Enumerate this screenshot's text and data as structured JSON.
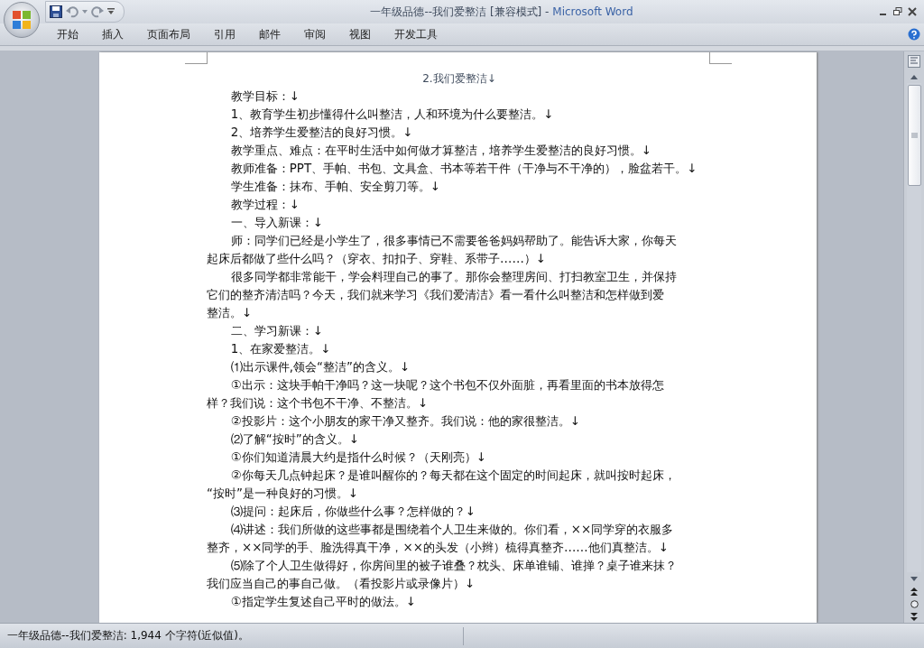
{
  "window": {
    "title": "一年级品德--我们爱整洁 [兼容模式]",
    "separator": "-",
    "app": "Microsoft Word"
  },
  "tabs": [
    {
      "label": "开始"
    },
    {
      "label": "插入"
    },
    {
      "label": "页面布局"
    },
    {
      "label": "引用"
    },
    {
      "label": "邮件"
    },
    {
      "label": "审阅"
    },
    {
      "label": "视图"
    },
    {
      "label": "开发工具"
    }
  ],
  "document": {
    "paragraphs": [
      {
        "kind": "title",
        "lines": [
          "2.我们爱整洁↓"
        ]
      },
      {
        "kind": "body",
        "lines": [
          "教学目标：↓"
        ]
      },
      {
        "kind": "body",
        "lines": [
          "1、教育学生初步懂得什么叫整洁，人和环境为什么要整洁。↓"
        ]
      },
      {
        "kind": "body",
        "lines": [
          "2、培养学生爱整洁的良好习惯。↓"
        ]
      },
      {
        "kind": "body",
        "lines": [
          "教学重点、难点：在平时生活中如何做才算整洁，培养学生爱整洁的良好习惯。↓"
        ]
      },
      {
        "kind": "body",
        "lines": [
          "教师准备：PPT、手帕、书包、文具盒、书本等若干件（干净与不干净的），脸盆若干。↓"
        ]
      },
      {
        "kind": "body",
        "lines": [
          "学生准备：抹布、手帕、安全剪刀等。↓"
        ]
      },
      {
        "kind": "body",
        "lines": [
          "教学过程：↓"
        ]
      },
      {
        "kind": "body",
        "lines": [
          "一、导入新课：↓"
        ]
      },
      {
        "kind": "body",
        "lines": [
          "师：同学们已经是小学生了，很多事情已不需要爸爸妈妈帮助了。能告诉大家，你每天",
          "起床后都做了些什么吗？（穿衣、扣扣子、穿鞋、系带子……）↓"
        ]
      },
      {
        "kind": "body",
        "lines": [
          "很多同学都非常能干，学会料理自己的事了。那你会整理房间、打扫教室卫生，并保持",
          "它们的整齐清洁吗？今天，我们就来学习《我们爱清洁》看一看什么叫整洁和怎样做到爱",
          "整洁。↓"
        ]
      },
      {
        "kind": "body",
        "lines": [
          "二、学习新课：↓"
        ]
      },
      {
        "kind": "body",
        "lines": [
          "1、在家爱整洁。↓"
        ]
      },
      {
        "kind": "body",
        "lines": [
          "⑴出示课件,领会“整洁”的含义。↓"
        ]
      },
      {
        "kind": "body",
        "lines": [
          "①出示：这块手帕干净吗？这一块呢？这个书包不仅外面脏，再看里面的书本放得怎",
          "样？我们说：这个书包不干净、不整洁。↓"
        ]
      },
      {
        "kind": "body",
        "lines": [
          "②投影片：这个小朋友的家干净又整齐。我们说：他的家很整洁。↓"
        ]
      },
      {
        "kind": "body",
        "lines": [
          "⑵了解“按时”的含义。↓"
        ]
      },
      {
        "kind": "body",
        "lines": [
          "①你们知道清晨大约是指什么时候？（天刚亮）↓"
        ]
      },
      {
        "kind": "body",
        "lines": [
          "②你每天几点钟起床？是谁叫醒你的？每天都在这个固定的时间起床，就叫按时起床，",
          "“按时”是一种良好的习惯。↓"
        ]
      },
      {
        "kind": "body",
        "lines": [
          "⑶提问：起床后，你做些什么事？怎样做的？↓"
        ]
      },
      {
        "kind": "body",
        "lines": [
          "⑷讲述：我们所做的这些事都是围绕着个人卫生来做的。你们看，××同学穿的衣服多",
          "整齐，××同学的手、脸洗得真干净，××的头发（小辫）梳得真整齐……他们真整洁。↓"
        ]
      },
      {
        "kind": "body",
        "lines": [
          "⑸除了个人卫生做得好，你房间里的被子谁叠？枕头、床单谁铺、谁掸？桌子谁来抹？",
          "我们应当自己的事自己做。（看投影片或录像片）↓"
        ]
      },
      {
        "kind": "body",
        "lines": [
          "①指定学生复述自己平时的做法。↓"
        ]
      }
    ]
  },
  "status_bar": {
    "text": "一年级品德--我们爱整洁: 1,944 个字符(近似值)。"
  }
}
